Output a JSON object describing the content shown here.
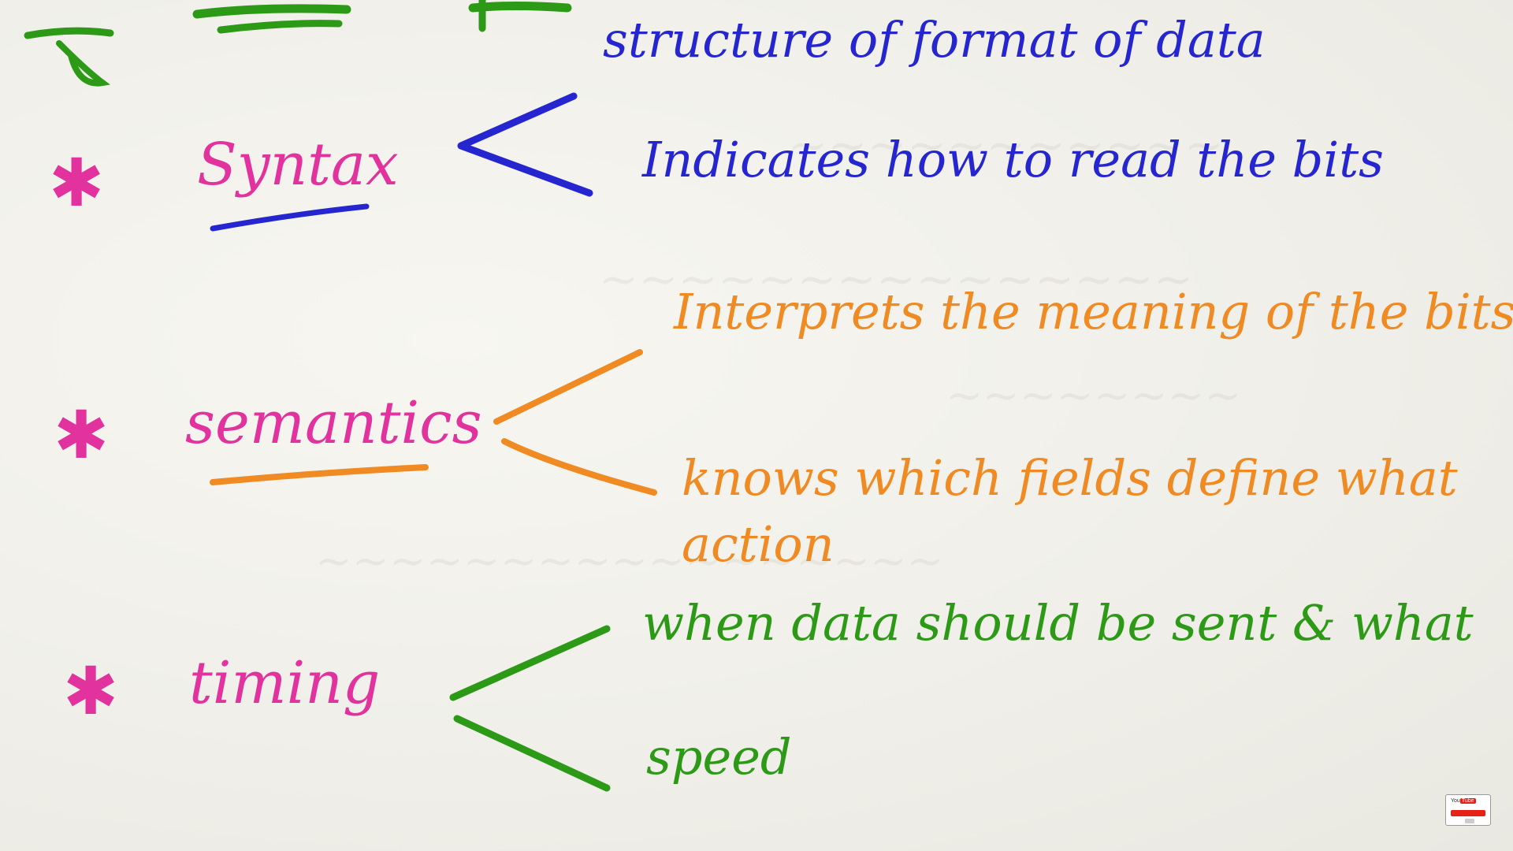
{
  "colors": {
    "magenta": "#e2329e",
    "blue": "#2626d0",
    "orange": "#f08a22",
    "green": "#2d9a17"
  },
  "terms": {
    "syntax": "Syntax",
    "semantics": "semantics",
    "timing": "timing"
  },
  "syntax_points": {
    "p1": "structure of format of data",
    "p2": "Indicates how to read the bits"
  },
  "semantics_points": {
    "p1": "Interprets the meaning of the bits",
    "p2": "knows which fields define what action"
  },
  "timing_points": {
    "p1": "when data should be sent & what",
    "p2": "speed"
  },
  "bullet_symbol": "✱",
  "icons": {
    "badge": "youtube-subscribe-icon"
  }
}
